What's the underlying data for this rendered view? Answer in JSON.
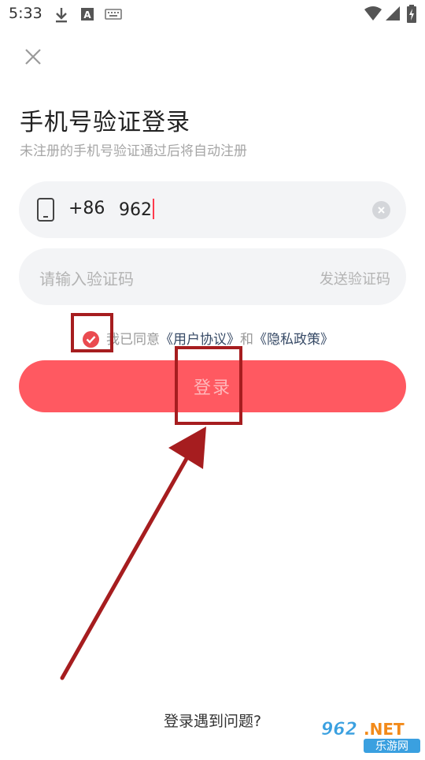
{
  "status_bar": {
    "time": "5:33",
    "left_icons": [
      "download-icon",
      "a-notification-icon",
      "keyboard-icon"
    ],
    "right_icons": [
      "wifi-icon",
      "signal-icon",
      "battery-charging-icon"
    ]
  },
  "header": {
    "close_icon": "close-icon",
    "title": "手机号验证登录",
    "subtitle": "未注册的手机号验证通过后将自动注册"
  },
  "phone_field": {
    "icon": "phone-icon",
    "country_code": "+86",
    "value": "962",
    "clear_icon": "clear-icon"
  },
  "code_field": {
    "placeholder": "请输入验证码",
    "send_code_label": "发送验证码"
  },
  "agreement": {
    "checked": true,
    "prefix": "我已同意",
    "user_agreement": "《用户协议》",
    "conjunction": "和",
    "privacy_policy": "《隐私政策》"
  },
  "login_button": {
    "label": "登录"
  },
  "footer": {
    "help_label": "登录遇到问题?"
  },
  "watermark": {
    "top": "962.NET",
    "bottom": "乐游网"
  },
  "colors": {
    "brand_red": "#ff5961",
    "annotation": "#a61d1f",
    "field_bg": "#f3f4f6",
    "link": "#374a66"
  }
}
